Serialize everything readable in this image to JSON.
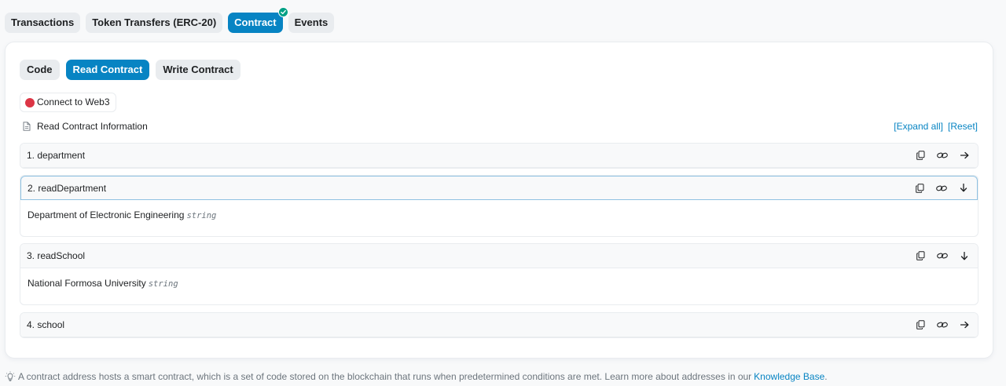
{
  "top_tabs": [
    {
      "label": "Transactions",
      "active": false
    },
    {
      "label": "Token Transfers (ERC-20)",
      "active": false
    },
    {
      "label": "Contract",
      "active": true,
      "verified": true
    },
    {
      "label": "Events",
      "active": false
    }
  ],
  "sub_tabs": [
    {
      "label": "Code",
      "active": false
    },
    {
      "label": "Read Contract",
      "active": true
    },
    {
      "label": "Write Contract",
      "active": false
    }
  ],
  "web3": {
    "label": "Connect to Web3",
    "status_color": "#dc3545"
  },
  "info": {
    "label": "Read Contract Information"
  },
  "links": {
    "expand_all": "[Expand all]",
    "reset": "[Reset]"
  },
  "functions": [
    {
      "label": "1. department",
      "open": false,
      "arrow": "right"
    },
    {
      "label": "2. readDepartment",
      "open": true,
      "arrow": "down",
      "result": "Department of Electronic Engineering",
      "type": "string"
    },
    {
      "label": "3. readSchool",
      "open": true,
      "arrow": "down",
      "result": "National Formosa University",
      "type": "string"
    },
    {
      "label": "4. school",
      "open": false,
      "arrow": "right"
    }
  ],
  "footer": {
    "text": "A contract address hosts a smart contract, which is a set of code stored on the blockchain that runs when predetermined conditions are met. Learn more about addresses in our",
    "link": "Knowledge Base",
    "end": "."
  },
  "colors": {
    "accent": "#0784c3",
    "verified": "#00a186",
    "disconnected": "#dc3545"
  }
}
